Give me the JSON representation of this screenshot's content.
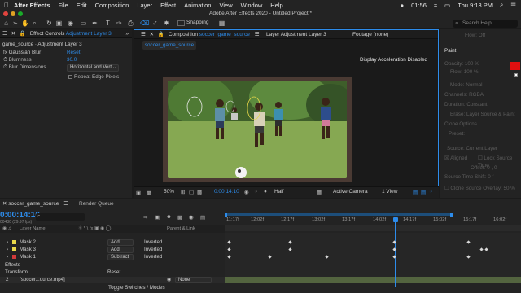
{
  "menubar": {
    "app": "After Effects",
    "items": [
      "File",
      "Edit",
      "Composition",
      "Layer",
      "Effect",
      "Animation",
      "View",
      "Window",
      "Help"
    ],
    "time": "01:56",
    "clock": "Thu 9:13 PM"
  },
  "window_title": "Adobe After Effects 2020 - Untitled Project *",
  "toolbar": {
    "snapping": "Snapping",
    "search_placeholder": "Search Help"
  },
  "effect_controls": {
    "tab_prefix": "Effect Controls",
    "layer_name": "Adjustment Layer 3",
    "breadcrumb": "game_source · Adjustment Layer 3",
    "effect_name": "Gaussian Blur",
    "reset": "Reset",
    "blurriness_label": "Blurriness",
    "blurriness_value": "30.0",
    "dimensions_label": "Blur Dimensions",
    "dimensions_value": "Horizontal and Vert",
    "repeat_label": "Repeat Edge Pixels"
  },
  "composition": {
    "tab_prefix": "Composition",
    "comp_name": "soccer_game_source",
    "layer_tab": "Layer Adjustment Layer 3",
    "footage_tab": "Footage (none)",
    "sub_tab": "soccer_game_source",
    "notice": "Display Acceleration Disabled"
  },
  "viewer_bar": {
    "zoom": "50%",
    "timecode": "0:00:14:10",
    "resolution": "Half",
    "camera": "Active Camera",
    "views": "1 View"
  },
  "right_panel": {
    "flow_label": "Flow:",
    "flow_value": "Off",
    "paint_title": "Paint",
    "opacity_label": "Opacity:",
    "opacity_value": "100 %",
    "flow2_label": "Flow:",
    "flow2_value": "100 %",
    "mode_label": "Mode:",
    "mode_value": "Normal",
    "channels_label": "Channels:",
    "channels_value": "RGBA",
    "duration_label": "Duration:",
    "duration_value": "Constant",
    "erase_label": "Erase:",
    "erase_value": "Layer Source & Paint",
    "clone_options": "Clone Options",
    "preset_label": "Preset:",
    "source_label": "Source:",
    "source_value": "Current Layer",
    "aligned": "Aligned",
    "lock_source": "Lock Source Time",
    "offset_label": "Offset:",
    "offset_value": "0 , 0",
    "source_shift": "Source Time Shift: 0 f",
    "clone_overlay": "Clone Source Overlay:",
    "clone_overlay_value": "50 %",
    "accent_color": "#e01010"
  },
  "timeline": {
    "comp_tab": "soccer_game_source",
    "render_tab": "Render Queue",
    "timecode": "0:00:14:10",
    "fps": "00430 (29.97 fps)",
    "col_layer": "Layer Name",
    "col_parent": "Parent & Link",
    "masks": [
      {
        "name": "Mask 2",
        "mode": "Add",
        "inverted": "Inverted",
        "color": "#e8d84a"
      },
      {
        "name": "Mask 3",
        "mode": "Add",
        "inverted": "Inverted",
        "color": "#e8d84a"
      },
      {
        "name": "Mask 1",
        "mode": "Subtract",
        "inverted": "Inverted",
        "color": "#d03a3a"
      }
    ],
    "effects": "Effects",
    "transform": "Transform",
    "transform_reset": "Reset",
    "layer_num": "2",
    "layer_name": "[soccer...ource.mp4]",
    "parent": "None",
    "toggle": "Toggle Switches / Modes",
    "ticks": [
      "11:17f",
      "12:02f",
      "12:17f",
      "13:02f",
      "13:17f",
      "14:02f",
      "14:17f",
      "15:02f",
      "15:17f",
      "16:02f"
    ]
  }
}
